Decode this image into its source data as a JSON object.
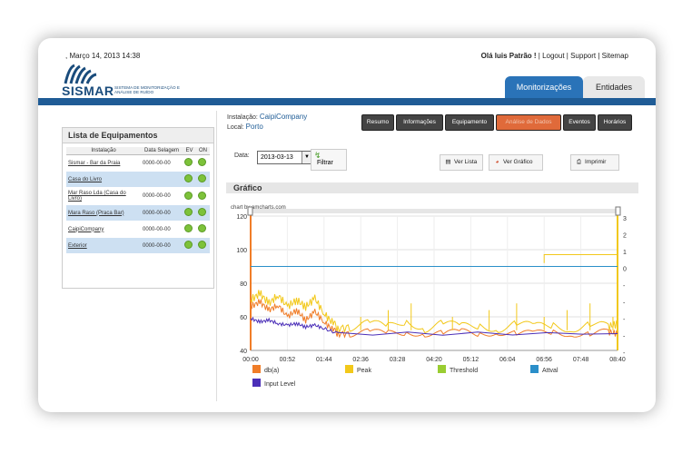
{
  "header": {
    "datetime": ", Março 14, 2013     14:38",
    "greeting": "Olá luis Patrão !",
    "links": [
      "Logout",
      "Support",
      "Sitemap"
    ]
  },
  "logo": {
    "name": "SISMAR",
    "subtitle": "SISTEMA DE MONITORIZAÇÃO E ANÁLISE DE RUÍDO"
  },
  "tabs": [
    {
      "label": "Monitorizações",
      "active": true
    },
    {
      "label": "Entidades",
      "active": false
    }
  ],
  "equipment": {
    "title": "Lista de Equipamentos",
    "columns": [
      "Instalação",
      "Data Selagem",
      "EV",
      "ON"
    ],
    "rows": [
      {
        "name": "Sismar - Bar da Praia",
        "date": "0000-00-00",
        "ev": true,
        "on": true
      },
      {
        "name": "Casa do Livro",
        "date": "",
        "ev": true,
        "on": true
      },
      {
        "name": "Mar Raso Lda (Casa do Livro)",
        "date": "0000-00-00",
        "ev": true,
        "on": true
      },
      {
        "name": "Mara Raso (Praca Bar)",
        "date": "0000-00-00",
        "ev": true,
        "on": true
      },
      {
        "name": "CaipiCompany",
        "date": "0000-00-00",
        "ev": true,
        "on": true
      },
      {
        "name": "Exterior",
        "date": "0000-00-00",
        "ev": true,
        "on": true
      }
    ]
  },
  "installation": {
    "label_install": "Instalação:",
    "install_value": "CaipiCompany",
    "label_local": "Local:",
    "local_value": "Porto"
  },
  "nav_buttons": [
    {
      "label": "Resumo",
      "active": false
    },
    {
      "label": "Informações",
      "active": false
    },
    {
      "label": "Equipamento",
      "active": false
    },
    {
      "label": "Análise de Dados",
      "active": true
    },
    {
      "label": "Eventos",
      "active": false
    },
    {
      "label": "Horários",
      "active": false
    }
  ],
  "filter": {
    "label": "Data:",
    "date": "2013-03-13",
    "button": "Filtrar"
  },
  "actions": {
    "list": "Ver Lista",
    "chart": "Ver Gráfico",
    "print": "Imprimir"
  },
  "section_title": "Gráfico",
  "chart_credit": "chart by amcharts.com",
  "colors": {
    "db": "#f07d28",
    "peak": "#f2c81a",
    "threshold": "#9acd32",
    "attval": "#2b8fc9",
    "input": "#4b2fb8",
    "accent": "#2a73b8"
  },
  "chart_data": {
    "type": "line",
    "x_ticks": [
      "00:00",
      "00:52",
      "01:44",
      "02:36",
      "03:28",
      "04:20",
      "05:12",
      "06:04",
      "06:56",
      "07:48",
      "08:40"
    ],
    "y_left_ticks": [
      40,
      60,
      80,
      100,
      120
    ],
    "y_left_range": [
      40,
      120
    ],
    "y_right_ticks": [
      "3",
      "2",
      "1",
      "0",
      "-",
      "-",
      "-",
      "-",
      "-"
    ],
    "series": [
      {
        "name": "db(a)",
        "points": [
          [
            0,
            66
          ],
          [
            10,
            69
          ],
          [
            20,
            64
          ],
          [
            30,
            67
          ],
          [
            40,
            60
          ],
          [
            50,
            64
          ],
          [
            60,
            58
          ],
          [
            70,
            63
          ],
          [
            80,
            57
          ],
          [
            90,
            52
          ],
          [
            95,
            50
          ],
          [
            110,
            50
          ],
          [
            130,
            51
          ],
          [
            150,
            50
          ],
          [
            170,
            51
          ],
          [
            190,
            50
          ],
          [
            210,
            50
          ],
          [
            230,
            51
          ],
          [
            250,
            50
          ],
          [
            270,
            51
          ],
          [
            290,
            50
          ],
          [
            310,
            50
          ],
          [
            330,
            51
          ],
          [
            350,
            50
          ],
          [
            370,
            50
          ],
          [
            390,
            51
          ],
          [
            400,
            50
          ]
        ]
      },
      {
        "name": "Peak",
        "points": [
          [
            0,
            70
          ],
          [
            10,
            74
          ],
          [
            20,
            68
          ],
          [
            30,
            73
          ],
          [
            40,
            66
          ],
          [
            50,
            70
          ],
          [
            60,
            66
          ],
          [
            70,
            71
          ],
          [
            80,
            62
          ],
          [
            90,
            56
          ],
          [
            95,
            53
          ],
          [
            110,
            54
          ],
          [
            130,
            56
          ],
          [
            150,
            54
          ],
          [
            170,
            58
          ],
          [
            190,
            53
          ],
          [
            210,
            56
          ],
          [
            230,
            54
          ],
          [
            250,
            55
          ],
          [
            270,
            53
          ],
          [
            290,
            56
          ],
          [
            310,
            54
          ],
          [
            330,
            55
          ],
          [
            350,
            53
          ],
          [
            370,
            56
          ],
          [
            390,
            54
          ],
          [
            400,
            56
          ]
        ]
      },
      {
        "name": "Threshold",
        "points": []
      },
      {
        "name": "Attval",
        "points": [
          [
            0,
            90
          ],
          [
            400,
            90
          ]
        ]
      },
      {
        "name": "Input Level",
        "points": [
          [
            0,
            59
          ],
          [
            10,
            57
          ],
          [
            20,
            58
          ],
          [
            30,
            56
          ],
          [
            40,
            55
          ],
          [
            50,
            56
          ],
          [
            60,
            54
          ],
          [
            70,
            55
          ],
          [
            80,
            53
          ],
          [
            95,
            50
          ],
          [
            400,
            50
          ]
        ]
      }
    ]
  }
}
